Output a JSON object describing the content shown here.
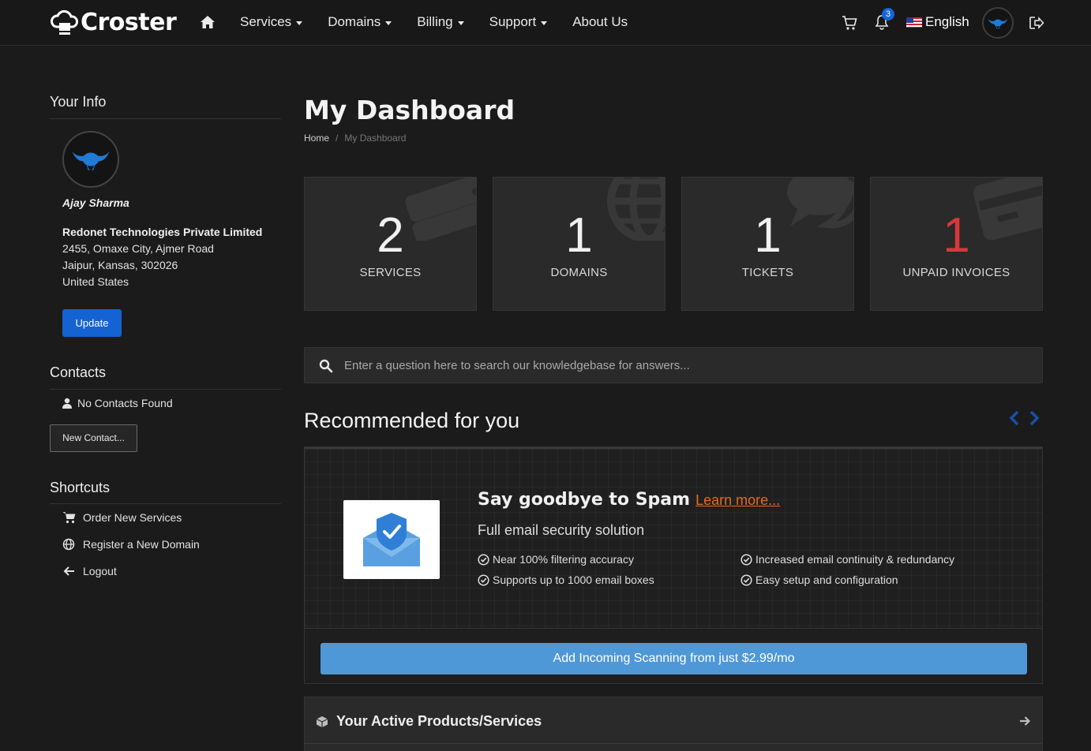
{
  "brand": {
    "name": "Croster"
  },
  "nav": {
    "items": [
      {
        "label": "Services",
        "dropdown": true
      },
      {
        "label": "Domains",
        "dropdown": true
      },
      {
        "label": "Billing",
        "dropdown": true
      },
      {
        "label": "Support",
        "dropdown": true
      },
      {
        "label": "About Us",
        "dropdown": false
      }
    ],
    "notifications_count": "3",
    "language": "English"
  },
  "sidebar": {
    "your_info": {
      "heading": "Your Info",
      "name": "Ajay Sharma",
      "company": "Redonet Technologies Private Limited",
      "address_line1": "2455, Omaxe City, Ajmer Road",
      "address_line2": "Jaipur, Kansas, 302026",
      "country": "United States",
      "update_label": "Update"
    },
    "contacts": {
      "heading": "Contacts",
      "empty_text": "No Contacts Found",
      "new_contact_label": "New Contact..."
    },
    "shortcuts": {
      "heading": "Shortcuts",
      "items": [
        {
          "label": "Order New Services",
          "icon": "cart-icon"
        },
        {
          "label": "Register a New Domain",
          "icon": "globe-icon"
        },
        {
          "label": "Logout",
          "icon": "arrow-left-icon"
        }
      ]
    }
  },
  "main": {
    "title": "My Dashboard",
    "breadcrumb": {
      "home": "Home",
      "separator": "/",
      "current": "My Dashboard"
    },
    "tiles": [
      {
        "value": "2",
        "label": "SERVICES",
        "icon": "cube-icon",
        "highlight": false
      },
      {
        "value": "1",
        "label": "DOMAINS",
        "icon": "globe-icon",
        "highlight": false
      },
      {
        "value": "1",
        "label": "TICKETS",
        "icon": "comments-icon",
        "highlight": false
      },
      {
        "value": "1",
        "label": "UNPAID INVOICES",
        "icon": "credit-card-icon",
        "highlight": true
      }
    ],
    "kb_search": {
      "placeholder": "Enter a question here to search our knowledgebase for answers..."
    },
    "recommended": {
      "heading": "Recommended for you",
      "promo": {
        "title": "Say goodbye to Spam",
        "link_label": "Learn more...",
        "subtitle": "Full email security solution",
        "features": [
          "Near 100% filtering accuracy",
          "Supports up to 1000 email boxes",
          "Increased email continuity & redundancy",
          "Easy setup and configuration"
        ],
        "cta_label": "Add Incoming Scanning from just $2.99/mo"
      }
    },
    "products_panel": {
      "title": "Your Active Products/Services"
    }
  },
  "colors": {
    "accent_blue": "#1563d3",
    "cta_blue": "#4f98d8",
    "link_orange": "#e4691f",
    "danger_red": "#d9383a",
    "background": "#1b1b1b"
  }
}
